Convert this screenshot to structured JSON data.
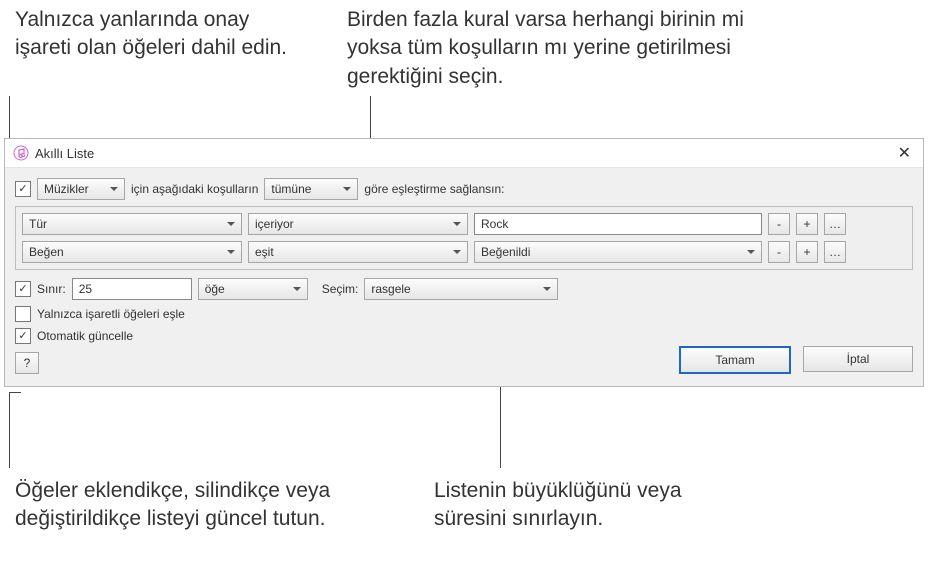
{
  "annotations": {
    "topLeft": "Yalnızca yanlarında onay işareti olan öğeleri dahil edin.",
    "topRight": "Birden fazla kural varsa herhangi birinin mi yoksa tüm koşulların mı yerine getirilmesi gerektiğini seçin.",
    "botLeft": "Öğeler eklendikçe, silindikçe veya değiştirildikçe listeyi güncel tutun.",
    "botRight": "Listenin büyüklüğünü veya süresini sınırlayın."
  },
  "dialog": {
    "title": "Akıllı Liste",
    "sourceSelect": "Müzikler",
    "matchText1": "için aşağıdaki koşulların",
    "matchSelect": "tümüne",
    "matchText2": "göre eşleştirme sağlansın:",
    "rules": [
      {
        "field": "Tür",
        "op": "içeriyor",
        "value": "Rock",
        "valueIsSelect": false
      },
      {
        "field": "Beğen",
        "op": "eşit",
        "value": "Beğenildi",
        "valueIsSelect": true
      }
    ],
    "limitLabel": "Sınır:",
    "limitValue": "25",
    "limitUnit": "öğe",
    "selectionLabel": "Seçim:",
    "selectionValue": "rasgele",
    "onlyChecked": "Yalnızca işaretli öğeleri eşle",
    "liveUpdate": "Otomatik güncelle",
    "help": "?",
    "ok": "Tamam",
    "cancel": "İptal",
    "minus": "-",
    "plus": "+",
    "more": "…"
  }
}
